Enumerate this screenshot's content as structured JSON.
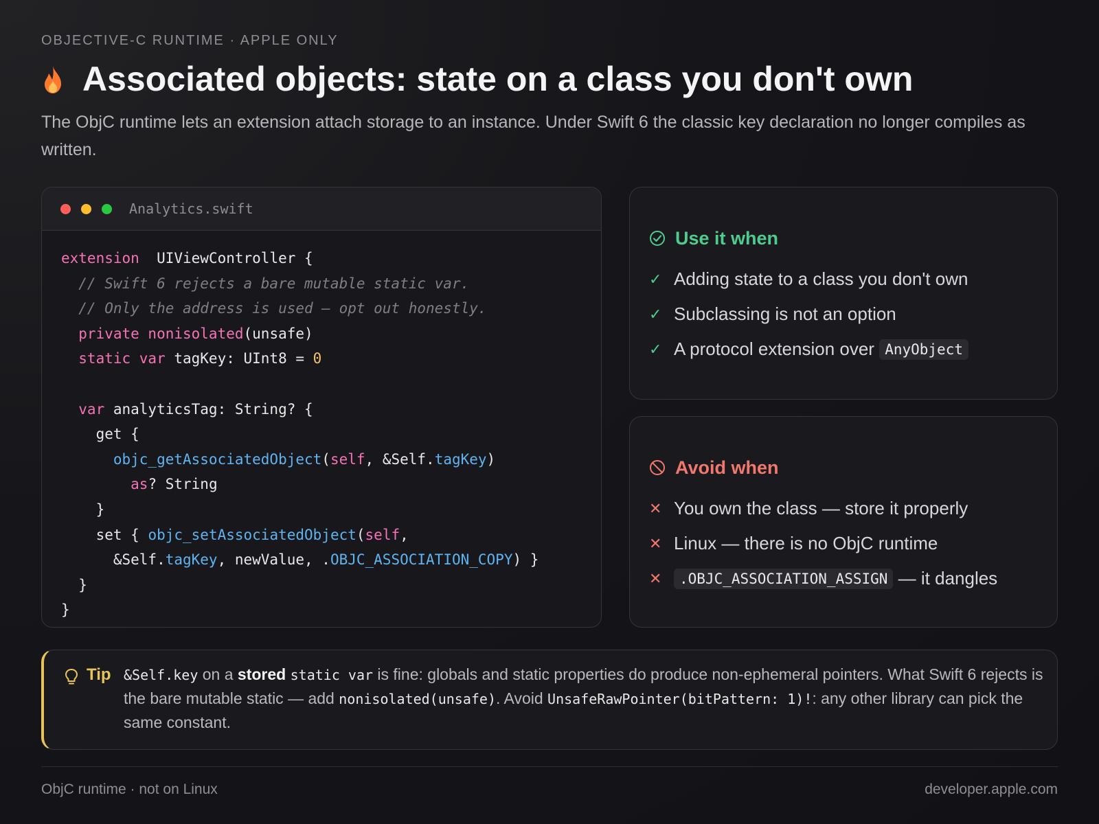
{
  "header": {
    "eyebrow": "OBJECTIVE-C RUNTIME · APPLE ONLY",
    "title": "Associated objects: state on a class you don't own",
    "lede": "The ObjC runtime lets an extension attach storage to an instance. Under Swift 6 the classic key declaration no longer compiles as written."
  },
  "code_card": {
    "filename": "Analytics.swift",
    "dots": [
      "#ff5f57",
      "#febc2e",
      "#28c840"
    ],
    "lines": [
      [
        [
          "kw",
          "extension"
        ],
        [
          "",
          "  UIViewController {"
        ]
      ],
      [
        [
          "cm",
          "  // Swift 6 rejects a bare mutable static var."
        ]
      ],
      [
        [
          "cm",
          "  // Only the address is used — opt out honestly."
        ]
      ],
      [
        [
          "kw",
          "  private nonisolated"
        ],
        [
          "",
          "(unsafe)"
        ]
      ],
      [
        [
          "kw",
          "  static var"
        ],
        [
          "",
          " tagKey: UInt8 = "
        ],
        [
          "num",
          "0"
        ]
      ],
      [],
      [
        [
          "kw",
          "  var"
        ],
        [
          "",
          " analyticsTag: String? {"
        ]
      ],
      [
        [
          "",
          "    get {"
        ]
      ],
      [
        [
          "fn",
          "      objc_getAssociatedObject"
        ],
        [
          "",
          "("
        ],
        [
          "kw",
          "self"
        ],
        [
          "",
          ", &Self."
        ],
        [
          "fn",
          "tagKey"
        ],
        [
          "",
          ")"
        ]
      ],
      [
        [
          "kw",
          "        as"
        ],
        [
          "",
          "? String"
        ]
      ],
      [
        [
          "",
          "    }"
        ]
      ],
      [
        [
          "",
          "    set { "
        ],
        [
          "fn",
          "objc_setAssociatedObject"
        ],
        [
          "",
          "("
        ],
        [
          "kw",
          "self"
        ],
        [
          "",
          ","
        ]
      ],
      [
        [
          "",
          "      &Self."
        ],
        [
          "fn",
          "tagKey"
        ],
        [
          "",
          ", newValue, ."
        ],
        [
          "fn",
          "OBJC_ASSOCIATION_COPY"
        ],
        [
          "",
          ") }"
        ]
      ],
      [
        [
          "",
          "  }"
        ]
      ],
      [
        [
          "",
          "}"
        ]
      ]
    ]
  },
  "use_when": {
    "title": "Use it when",
    "items": [
      {
        "text": "Adding state to a class you don't own"
      },
      {
        "text": "Subclassing is not an option"
      },
      {
        "text": "A protocol extension over ",
        "code": "AnyObject"
      }
    ]
  },
  "avoid_when": {
    "title": "Avoid when",
    "items": [
      {
        "text": "You own the class — store it properly"
      },
      {
        "text": "Linux — there is no ObjC runtime"
      },
      {
        "code": ".OBJC_ASSOCIATION_ASSIGN",
        "text": " — it dangles"
      }
    ]
  },
  "tip": {
    "label": "Tip",
    "parts": [
      [
        "code",
        "&Self.key"
      ],
      [
        "text",
        " on a "
      ],
      [
        "bold",
        "stored"
      ],
      [
        "text",
        " "
      ],
      [
        "code",
        "static var"
      ],
      [
        "text",
        " is fine: globals and static properties do produce non-ephemeral pointers. What Swift 6 rejects is the bare mutable static — add "
      ],
      [
        "code",
        "nonisolated(unsafe)"
      ],
      [
        "text",
        ". Avoid "
      ],
      [
        "code",
        "UnsafeRawPointer(bitPattern: 1)!"
      ],
      [
        "text",
        ": any other library can pick the same constant."
      ]
    ]
  },
  "footer": {
    "left": "ObjC runtime · not on Linux",
    "right": "developer.apple.com"
  },
  "colors": {
    "accent_green": "#4ecb8f",
    "accent_red": "#f0786d",
    "accent_yellow": "#e8c35a",
    "keyword_pink": "#f472b6",
    "function_blue": "#5fb3f0"
  }
}
